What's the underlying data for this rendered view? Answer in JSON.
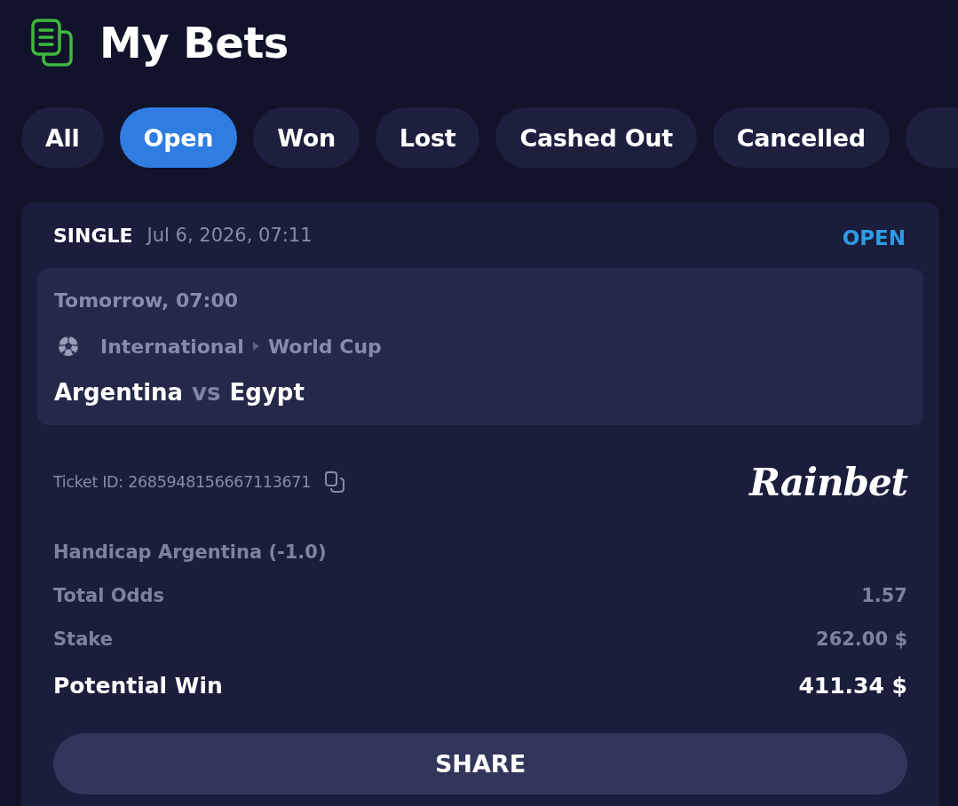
{
  "page": {
    "title": "My Bets"
  },
  "tabs": [
    {
      "label": "All",
      "selected": false
    },
    {
      "label": "Open",
      "selected": true
    },
    {
      "label": "Won",
      "selected": false
    },
    {
      "label": "Lost",
      "selected": false
    },
    {
      "label": "Cashed Out",
      "selected": false
    },
    {
      "label": "Cancelled",
      "selected": false
    },
    {
      "selected": false
    }
  ],
  "bet": {
    "type": "SINGLE",
    "placed": "Jul 6, 2026, 07:11",
    "status": "OPEN",
    "event": {
      "start": "Tomorrow, 07:00",
      "path": [
        "International",
        "World Cup"
      ],
      "home": "Argentina",
      "versus": "vs",
      "away": "Egypt"
    },
    "ticket_id": "Ticket ID: 2685948156667113671",
    "logo": "Rainbet",
    "selection": "Handicap Argentina (-1.0)",
    "lines": [
      {
        "kind": "normal",
        "label": "Total Odds",
        "value": "1.57"
      },
      {
        "kind": "normal",
        "label": "Stake",
        "value": "262.00 $"
      },
      {
        "kind": "total",
        "label": "Potential Win",
        "value": "411.34 $"
      }
    ],
    "share_button": "SHARE"
  }
}
